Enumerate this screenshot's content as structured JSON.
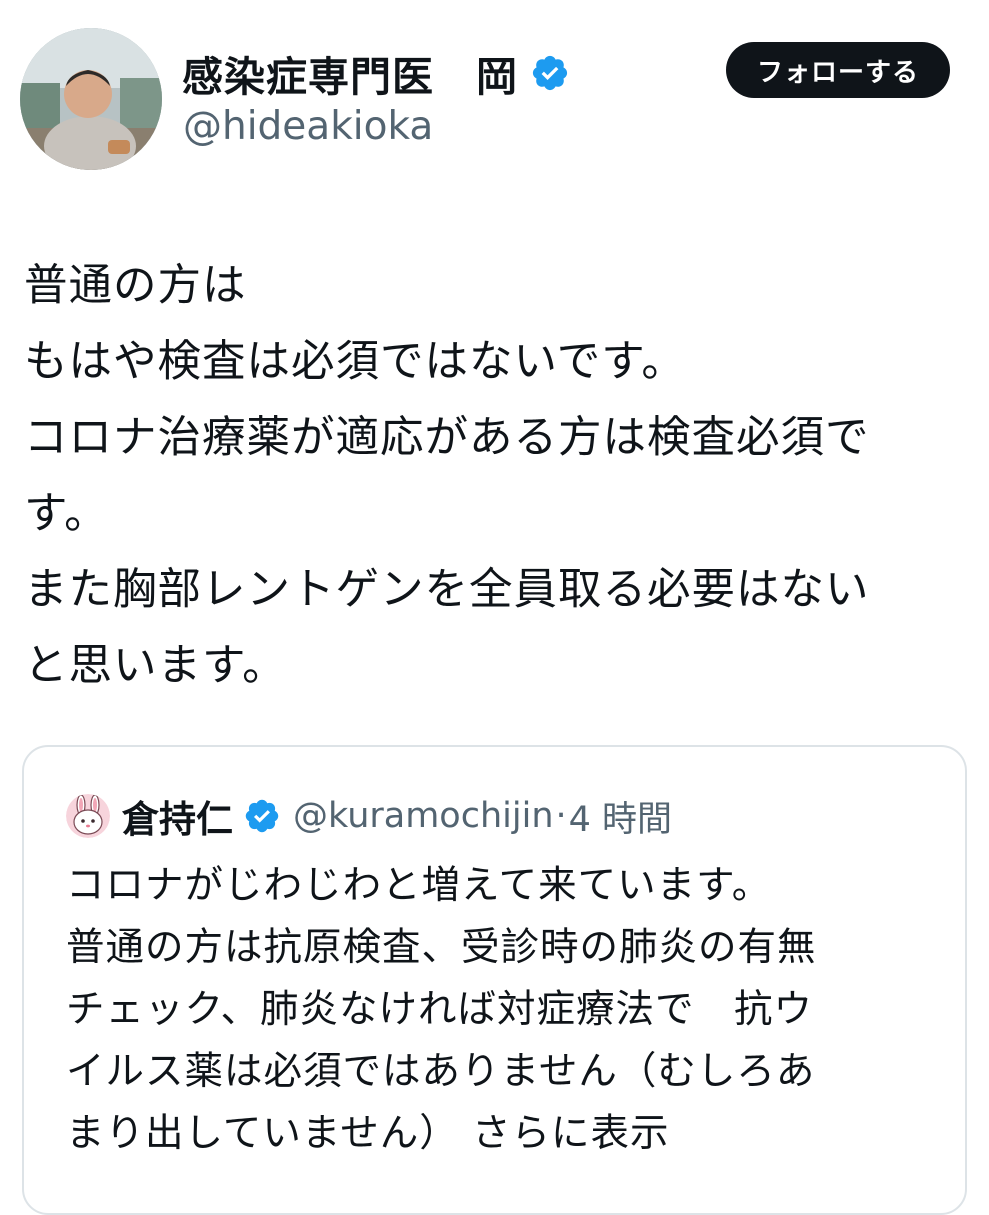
{
  "author": {
    "display_name": "感染症専門医　岡",
    "handle": "@hideakioka",
    "verified": true,
    "avatar_icon": "user-photo-avatar"
  },
  "follow_button": {
    "label": "フォローする"
  },
  "tweet": {
    "lines": [
      "普通の方は",
      "もはや検査は必須ではないです。",
      "コロナ治療薬が適応がある方は検査必須で",
      "す。",
      "また胸部レントゲンを全員取る必要はない",
      "と思います。"
    ]
  },
  "quoted_tweet": {
    "avatar_icon": "rabbit-face-avatar",
    "display_name": "倉持仁",
    "verified": true,
    "handle": "@kuramochijin",
    "separator": "·",
    "time": "4 時間",
    "lines": [
      "コロナがじわじわと増えて来ています。",
      "普通の方は抗原検査、受診時の肺炎の有無",
      "チェック、肺炎なければ対症療法で　抗ウ",
      "イルス薬は必須ではありません（むしろあ"
    ],
    "last_line_text": "まり出していません）",
    "show_more": "さらに表示"
  },
  "colors": {
    "text_primary": "#0f1419",
    "text_secondary": "#536471",
    "verified_blue": "#1d9bf0",
    "card_border": "#dde3e7",
    "button_bg": "#0f1419"
  }
}
